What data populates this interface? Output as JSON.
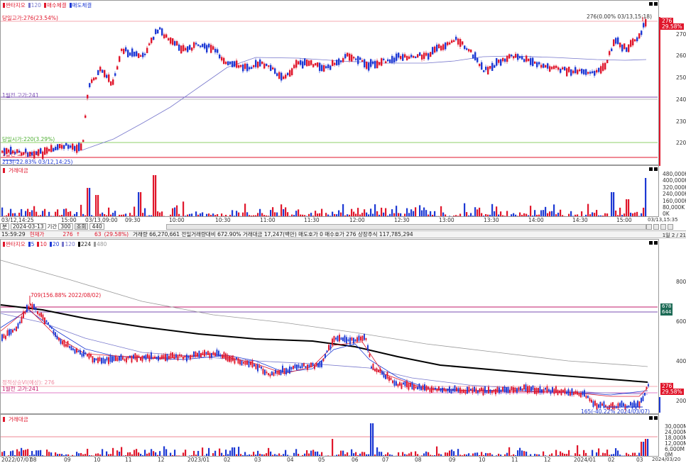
{
  "top_chart": {
    "legend": [
      {
        "label": "짠타지오",
        "color": "#e0162b"
      },
      {
        "label": "120",
        "color": "#7777cc"
      },
      {
        "label": "매수체결",
        "color": "#e0162b"
      },
      {
        "label": "매도체결",
        "color": "#1d39d4"
      }
    ],
    "annotations": {
      "high_line": "당일고가:276(23.54%)",
      "high_point": "276(0.00% 03/13,15:18)",
      "month_high": "1월전 고가:241",
      "open_price": "당일시가:220(3.29%)",
      "low_prev": "1일전 고가:214",
      "low_point": "213(-22.83% 03/12,14:25)"
    },
    "price_tag_top": "276",
    "price_tag_pct": "29.58%",
    "y_ticks": [
      "270",
      "260",
      "250",
      "240",
      "230",
      "220"
    ],
    "x_ticks": [
      "03/12,14:25",
      "15:00",
      "03/13,09:00",
      "09:30",
      "10:00",
      "10:30",
      "11:00",
      "11:30",
      "12:00",
      "12:30",
      "13:00",
      "13:30",
      "14:00",
      "14:30",
      "15:00",
      "03/13,15:35"
    ]
  },
  "top_volume": {
    "legend": "거래대금",
    "y_ticks": [
      "480,000K",
      "400,000K",
      "320,000K",
      "240,000K",
      "160,000K",
      "80,000K",
      "0K"
    ]
  },
  "controls": {
    "mode": "분",
    "date": "2024-03-13",
    "period_label": "기간",
    "count": "300",
    "query_label": "조회",
    "count2": "440"
  },
  "info_bar": {
    "time": "15:59:29",
    "current_label": "현재가",
    "price": "276",
    "arrow": "↑",
    "change": "63",
    "change_pct": "(29.58%)",
    "text": "거래량 66,270,661  전일거래량대비 672.90%  거래대금 17,247(백만)  매도호가 0  매수호가 276  상장주식 117,785,294"
  },
  "bottom_chart": {
    "legend": [
      {
        "label": "짠타지오",
        "color": "#e0162b"
      },
      {
        "label": "5",
        "color": "#1d39d4"
      },
      {
        "label": "10",
        "color": "#e0162b"
      },
      {
        "label": "20",
        "color": "#1d39d4"
      },
      {
        "label": "120",
        "color": "#7777cc"
      },
      {
        "label": "224",
        "color": "#000000"
      },
      {
        "label": "480",
        "color": "#999999"
      }
    ],
    "annotations": {
      "peak": "709(156.88% 2022/08/02)",
      "upper_limit": "정적상승VI(예상): 276",
      "month_high": "1월전 고가:241",
      "low_point": "165(-40.22% 2024/03/07)"
    },
    "right_tags": [
      "678",
      "644"
    ],
    "price_tag_top": "276",
    "price_tag_pct": "29.58%",
    "page_label": "1일 2 / 21",
    "y_ticks": [
      "800",
      "600",
      "400",
      "200"
    ],
    "x_ticks": [
      "2022/07/07",
      "08",
      "09",
      "10",
      "11",
      "12",
      "2023/01",
      "02",
      "03",
      "04",
      "05",
      "06",
      "07",
      "08",
      "09",
      "10",
      "11",
      "12",
      "2024/01",
      "02",
      "03",
      "2024/03/20"
    ]
  },
  "bottom_volume": {
    "legend": "거래대금",
    "y_ticks": [
      "30,000M",
      "24,000M",
      "18,000M",
      "12,000M",
      "6,000M",
      "0M"
    ]
  }
}
